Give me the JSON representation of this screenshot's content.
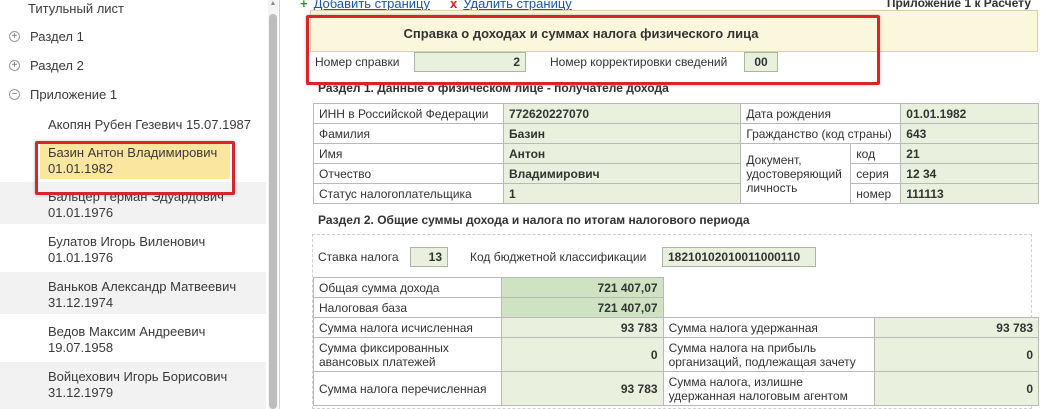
{
  "sidebar": {
    "items": [
      {
        "label": "Титульный лист",
        "toggle": ""
      },
      {
        "label": "Раздел 1",
        "toggle": "+"
      },
      {
        "label": "Раздел 2",
        "toggle": "+"
      },
      {
        "label": "Приложение 1",
        "toggle": "−"
      }
    ],
    "persons": [
      {
        "line1": "Акопян Рубен Гезевич 15.07.1987",
        "line2": ""
      },
      {
        "line1": "Базин Антон Владимирович",
        "line2": "01.01.1982"
      },
      {
        "line1": "Бальцер Герман Эдуардович",
        "line2": "01.01.1976"
      },
      {
        "line1": "Булатов Игорь Виленович",
        "line2": "01.01.1976"
      },
      {
        "line1": "Ваньков Александр Матвеевич",
        "line2": "31.12.1974"
      },
      {
        "line1": "Ведов Максим Андреевич",
        "line2": "19.07.1958"
      },
      {
        "line1": "Войцехович Игорь Борисович",
        "line2": "31.12.1979"
      }
    ]
  },
  "toolbar": {
    "add_page": "Добавить страницу",
    "delete_page": "Удалить страницу",
    "appendix": "Приложение 1 к Расчету"
  },
  "header": {
    "title": "Справка о доходах и суммах налога физического лица",
    "cert_number_label": "Номер справки",
    "cert_number": "2",
    "correction_label": "Номер корректировки сведений",
    "correction": "00"
  },
  "section1": {
    "title": "Раздел 1. Данные о физическом лице - получателе дохода",
    "inn_label": "ИНН в Российской Федерации",
    "inn": "772620227070",
    "surname_label": "Фамилия",
    "surname": "Базин",
    "name_label": "Имя",
    "name": "Антон",
    "patronymic_label": "Отчество",
    "patronymic": "Владимирович",
    "status_label": "Статус налогоплательщика",
    "status": "1",
    "birth_label": "Дата рождения",
    "birth": "01.01.1982",
    "citizenship_label": "Гражданство (код страны)",
    "citizenship": "643",
    "doc_label": "Документ, удостоверяющий личность",
    "doc_code_label": "код",
    "doc_code": "21",
    "doc_series_label": "серия",
    "doc_series": "12 34",
    "doc_number_label": "номер",
    "doc_number": "111113"
  },
  "section2": {
    "title": "Раздел 2. Общие суммы дохода и налога по итогам налогового периода",
    "rate_label": "Ставка налога",
    "rate": "13",
    "kbk_label": "Код бюджетной классификации",
    "kbk": "18210102010011000110",
    "total_income_label": "Общая сумма дохода",
    "total_income": "721 407,07",
    "tax_base_label": "Налоговая база",
    "tax_base": "721 407,07",
    "tax_calc_label": "Сумма налога исчисленная",
    "tax_calc": "93 783",
    "tax_withheld_label": "Сумма налога удержанная",
    "tax_withheld": "93 783",
    "fixed_adv_label": "Сумма фиксированных авансовых платежей",
    "fixed_adv": "0",
    "profit_tax_label": "Сумма налога на прибыль организаций, подлежащая зачету",
    "profit_tax": "0",
    "transferred_label": "Сумма налога перечисленная",
    "transferred": "93 783",
    "excess_label": "Сумма налога, излишне удержанная налоговым агентом",
    "excess": "0"
  }
}
